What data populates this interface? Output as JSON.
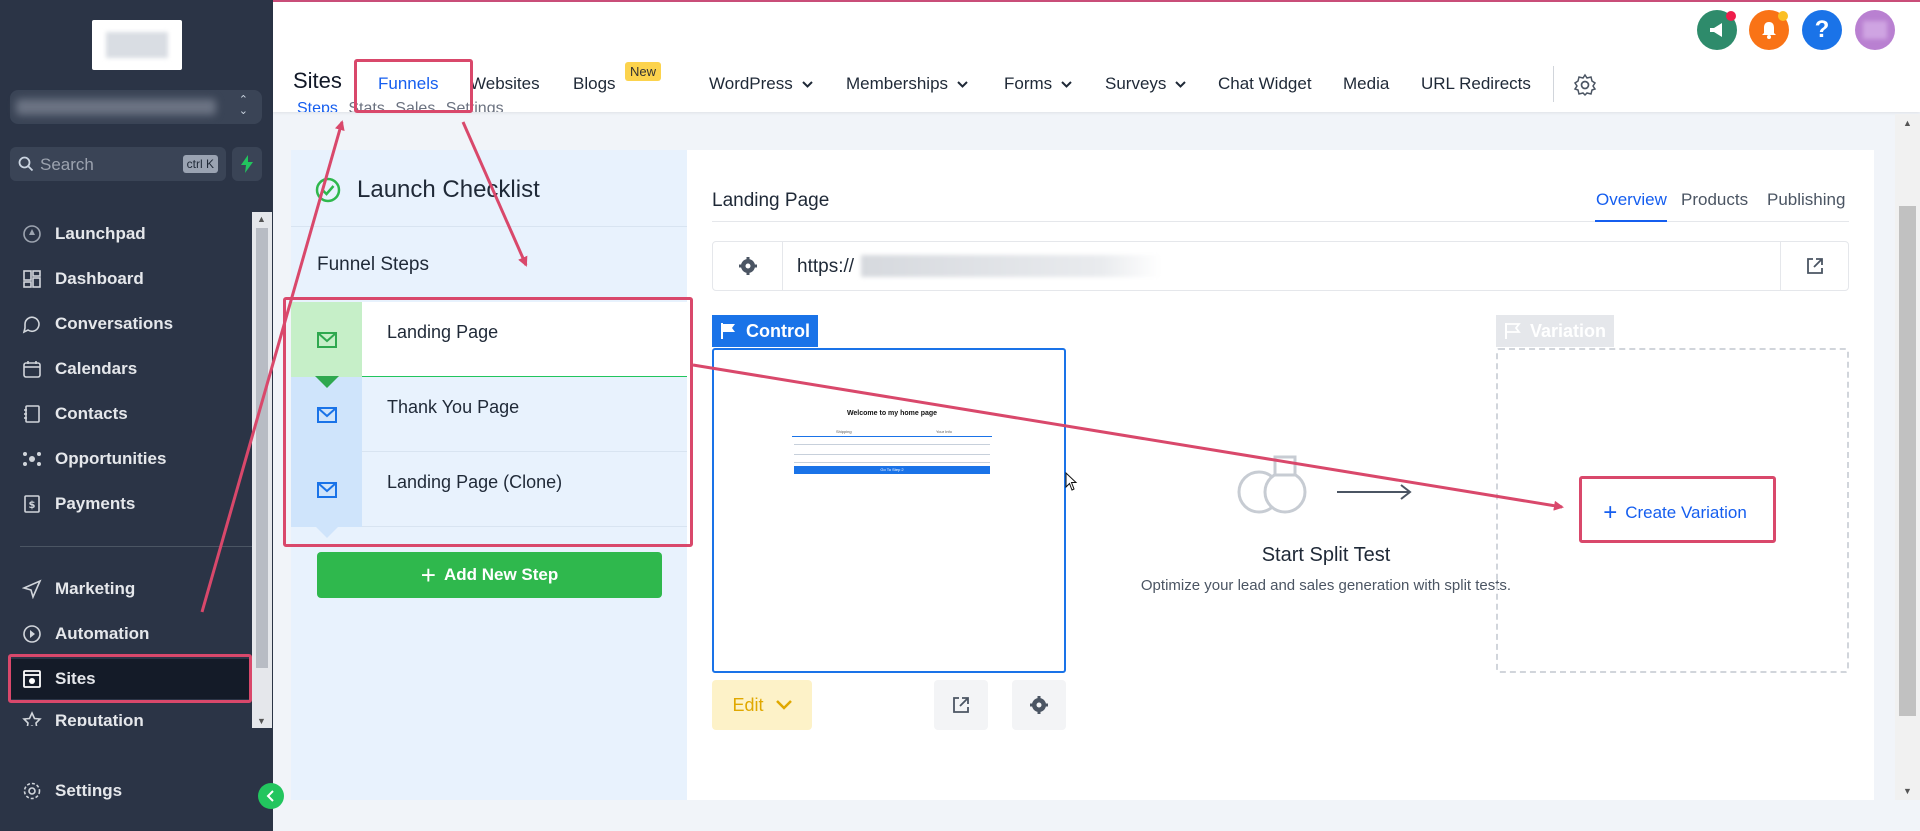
{
  "sidebar": {
    "search_placeholder": "Search",
    "search_shortcut": "ctrl K",
    "items": [
      {
        "label": "Launchpad",
        "icon": "rocket-icon"
      },
      {
        "label": "Dashboard",
        "icon": "grid-icon"
      },
      {
        "label": "Conversations",
        "icon": "chat-icon"
      },
      {
        "label": "Calendars",
        "icon": "calendar-icon"
      },
      {
        "label": "Contacts",
        "icon": "contacts-icon"
      },
      {
        "label": "Opportunities",
        "icon": "pipeline-icon"
      },
      {
        "label": "Payments",
        "icon": "payments-icon"
      },
      {
        "label": "Marketing",
        "icon": "send-icon"
      },
      {
        "label": "Automation",
        "icon": "automation-icon"
      },
      {
        "label": "Sites",
        "icon": "sites-icon",
        "active": true
      },
      {
        "label": "Reputation",
        "icon": "star-icon"
      }
    ],
    "settings_label": "Settings"
  },
  "header": {
    "title": "Sites",
    "tabs": {
      "funnels": "Funnels",
      "websites": "Websites",
      "blogs": "Blogs",
      "wordpress": "WordPress",
      "memberships": "Memberships",
      "forms": "Forms",
      "surveys": "Surveys",
      "chat_widget": "Chat Widget",
      "media": "Media",
      "url_redirects": "URL Redirects"
    },
    "new_badge": "New",
    "notification_colors": {
      "announcements": "#2e8b6b",
      "notifications": "#f97316",
      "help": "#1a73e8",
      "avatar": "#b980d1"
    }
  },
  "subtabs": [
    "Steps",
    "Stats",
    "Sales",
    "Settings"
  ],
  "left_panel": {
    "checklist_title": "Launch Checklist",
    "funnel_steps_title": "Funnel Steps",
    "steps": [
      {
        "label": "Landing Page"
      },
      {
        "label": "Thank You Page"
      },
      {
        "label": "Landing Page (Clone)"
      }
    ],
    "add_step_label": "Add New Step"
  },
  "right_panel": {
    "page_name": "Landing Page",
    "tabs": {
      "overview": "Overview",
      "products": "Products",
      "publishing": "Publishing"
    },
    "url_prefix": "https://",
    "control_label": "Control",
    "preview_title": "Welcome to my home page",
    "preview_col_1": "Shipping",
    "preview_col_2": "Your Info",
    "preview_button": "Go To Step 2",
    "edit_label": "Edit",
    "split_test_title": "Start Split Test",
    "split_test_desc": "Optimize your lead and sales generation with split tests.",
    "variation_label": "Variation",
    "create_variation_label": "Create Variation"
  },
  "colors": {
    "primary": "#155eef",
    "green": "#2fb84d",
    "annotation": "#d9486b",
    "sidebar_bg": "#2b3446"
  }
}
